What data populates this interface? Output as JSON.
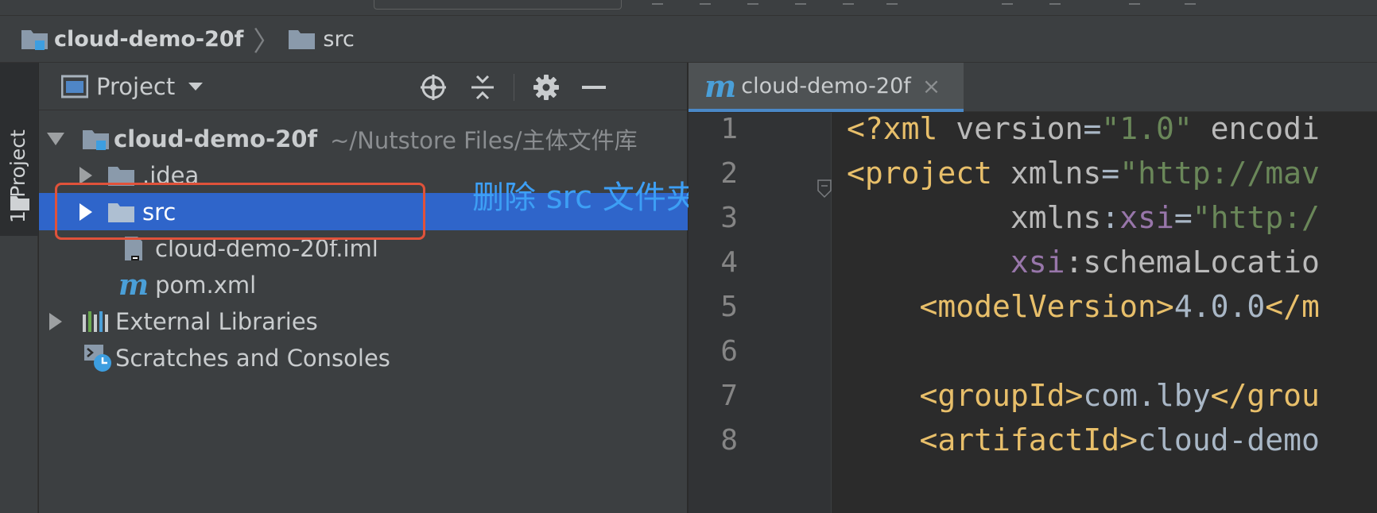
{
  "breadcrumb": {
    "root": "cloud-demo-20f",
    "separator": "〉",
    "child": "src"
  },
  "stripe": {
    "label": "1: Project"
  },
  "project_panel": {
    "title": "Project",
    "icons": [
      "locate-icon",
      "collapse-all-icon",
      "gear-icon",
      "minimize-icon"
    ]
  },
  "tree": [
    {
      "label": "cloud-demo-20f",
      "path": "~/Nutstore Files/主体文件库",
      "icon": "module-folder-icon",
      "expanded": true
    },
    {
      "label": ".idea",
      "icon": "folder-icon",
      "expanded": false
    },
    {
      "label": "src",
      "icon": "folder-icon",
      "expanded": false,
      "selected": true
    },
    {
      "label": "cloud-demo-20f.iml",
      "icon": "iml-file-icon"
    },
    {
      "label": "pom.xml",
      "icon": "maven-file-icon"
    },
    {
      "label": "External Libraries",
      "icon": "libraries-icon",
      "expanded": false
    },
    {
      "label": "Scratches and Consoles",
      "icon": "scratches-icon"
    }
  ],
  "annotation": {
    "text": "删除 src 文件夹",
    "color": "#3d9ff5",
    "box_color": "#e0523a"
  },
  "editor": {
    "tab": {
      "icon_glyph": "m",
      "label": "cloud-demo-20f",
      "close": "×"
    },
    "line_numbers": [
      "1",
      "2",
      "3",
      "4",
      "5",
      "6",
      "7",
      "8"
    ],
    "lines": [
      [
        {
          "t": "<?xml ",
          "c": "tag"
        },
        {
          "t": "version",
          "c": "attr"
        },
        {
          "t": "=",
          "c": "text"
        },
        {
          "t": "\"1.0\"",
          "c": "val"
        },
        {
          "t": " encodi",
          "c": "attr"
        }
      ],
      [
        {
          "t": "<project ",
          "c": "tag"
        },
        {
          "t": "xmlns",
          "c": "attr"
        },
        {
          "t": "=",
          "c": "text"
        },
        {
          "t": "\"http://mav",
          "c": "val"
        }
      ],
      [
        {
          "t": "         ",
          "c": "text"
        },
        {
          "t": "xmlns",
          "c": "attr"
        },
        {
          "t": ":",
          "c": "text"
        },
        {
          "t": "xsi",
          "c": "ns"
        },
        {
          "t": "=",
          "c": "text"
        },
        {
          "t": "\"http:/",
          "c": "val"
        }
      ],
      [
        {
          "t": "         ",
          "c": "text"
        },
        {
          "t": "xsi",
          "c": "ns"
        },
        {
          "t": ":schemaLocatio",
          "c": "attr"
        }
      ],
      [
        {
          "t": "    ",
          "c": "text"
        },
        {
          "t": "<modelVersion>",
          "c": "tag"
        },
        {
          "t": "4.0.0",
          "c": "text"
        },
        {
          "t": "</m",
          "c": "tag"
        }
      ],
      [],
      [
        {
          "t": "    ",
          "c": "text"
        },
        {
          "t": "<groupId>",
          "c": "tag"
        },
        {
          "t": "com.lby",
          "c": "text"
        },
        {
          "t": "</grou",
          "c": "tag"
        }
      ],
      [
        {
          "t": "    ",
          "c": "text"
        },
        {
          "t": "<artifactId>",
          "c": "tag"
        },
        {
          "t": "cloud-demo",
          "c": "text"
        }
      ]
    ]
  },
  "colors": {
    "selection": "#2f65ca",
    "editor_bg": "#2b2b2b",
    "panel_bg": "#3c3f41"
  }
}
